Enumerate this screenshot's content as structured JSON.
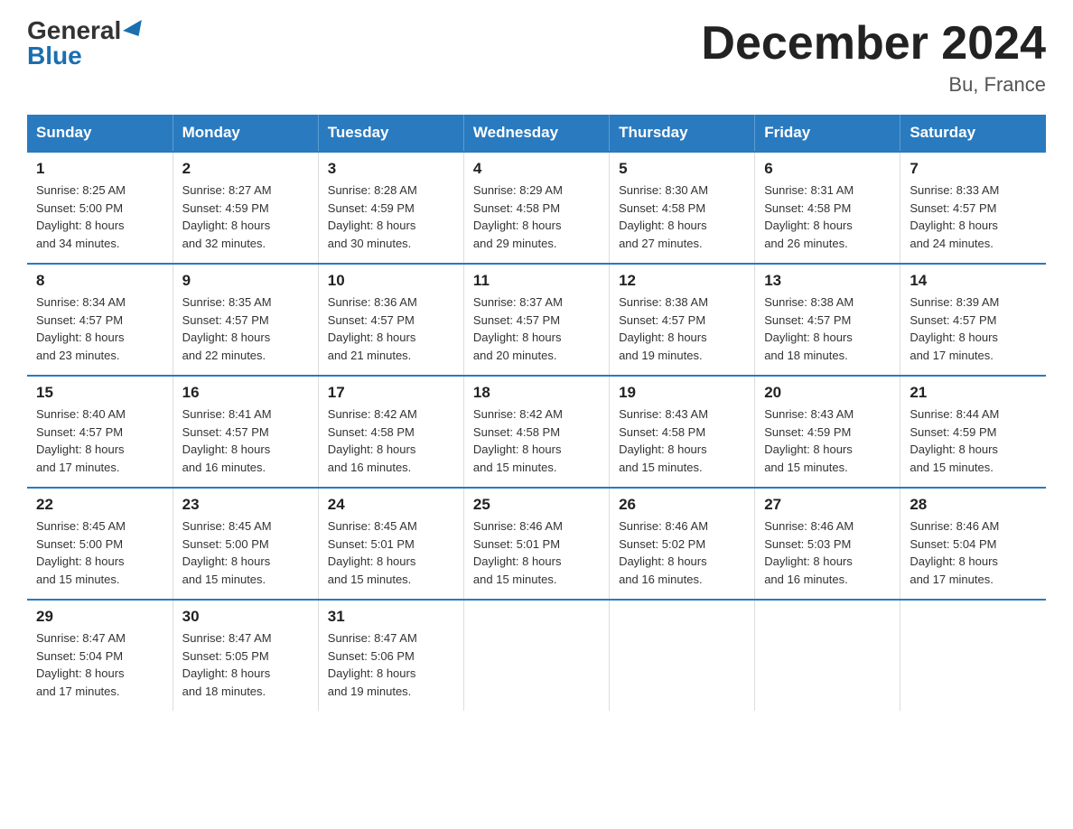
{
  "logo": {
    "general": "General",
    "blue": "Blue"
  },
  "title": "December 2024",
  "location": "Bu, France",
  "days_of_week": [
    "Sunday",
    "Monday",
    "Tuesday",
    "Wednesday",
    "Thursday",
    "Friday",
    "Saturday"
  ],
  "weeks": [
    [
      {
        "day": "1",
        "info": "Sunrise: 8:25 AM\nSunset: 5:00 PM\nDaylight: 8 hours\nand 34 minutes."
      },
      {
        "day": "2",
        "info": "Sunrise: 8:27 AM\nSunset: 4:59 PM\nDaylight: 8 hours\nand 32 minutes."
      },
      {
        "day": "3",
        "info": "Sunrise: 8:28 AM\nSunset: 4:59 PM\nDaylight: 8 hours\nand 30 minutes."
      },
      {
        "day": "4",
        "info": "Sunrise: 8:29 AM\nSunset: 4:58 PM\nDaylight: 8 hours\nand 29 minutes."
      },
      {
        "day": "5",
        "info": "Sunrise: 8:30 AM\nSunset: 4:58 PM\nDaylight: 8 hours\nand 27 minutes."
      },
      {
        "day": "6",
        "info": "Sunrise: 8:31 AM\nSunset: 4:58 PM\nDaylight: 8 hours\nand 26 minutes."
      },
      {
        "day": "7",
        "info": "Sunrise: 8:33 AM\nSunset: 4:57 PM\nDaylight: 8 hours\nand 24 minutes."
      }
    ],
    [
      {
        "day": "8",
        "info": "Sunrise: 8:34 AM\nSunset: 4:57 PM\nDaylight: 8 hours\nand 23 minutes."
      },
      {
        "day": "9",
        "info": "Sunrise: 8:35 AM\nSunset: 4:57 PM\nDaylight: 8 hours\nand 22 minutes."
      },
      {
        "day": "10",
        "info": "Sunrise: 8:36 AM\nSunset: 4:57 PM\nDaylight: 8 hours\nand 21 minutes."
      },
      {
        "day": "11",
        "info": "Sunrise: 8:37 AM\nSunset: 4:57 PM\nDaylight: 8 hours\nand 20 minutes."
      },
      {
        "day": "12",
        "info": "Sunrise: 8:38 AM\nSunset: 4:57 PM\nDaylight: 8 hours\nand 19 minutes."
      },
      {
        "day": "13",
        "info": "Sunrise: 8:38 AM\nSunset: 4:57 PM\nDaylight: 8 hours\nand 18 minutes."
      },
      {
        "day": "14",
        "info": "Sunrise: 8:39 AM\nSunset: 4:57 PM\nDaylight: 8 hours\nand 17 minutes."
      }
    ],
    [
      {
        "day": "15",
        "info": "Sunrise: 8:40 AM\nSunset: 4:57 PM\nDaylight: 8 hours\nand 17 minutes."
      },
      {
        "day": "16",
        "info": "Sunrise: 8:41 AM\nSunset: 4:57 PM\nDaylight: 8 hours\nand 16 minutes."
      },
      {
        "day": "17",
        "info": "Sunrise: 8:42 AM\nSunset: 4:58 PM\nDaylight: 8 hours\nand 16 minutes."
      },
      {
        "day": "18",
        "info": "Sunrise: 8:42 AM\nSunset: 4:58 PM\nDaylight: 8 hours\nand 15 minutes."
      },
      {
        "day": "19",
        "info": "Sunrise: 8:43 AM\nSunset: 4:58 PM\nDaylight: 8 hours\nand 15 minutes."
      },
      {
        "day": "20",
        "info": "Sunrise: 8:43 AM\nSunset: 4:59 PM\nDaylight: 8 hours\nand 15 minutes."
      },
      {
        "day": "21",
        "info": "Sunrise: 8:44 AM\nSunset: 4:59 PM\nDaylight: 8 hours\nand 15 minutes."
      }
    ],
    [
      {
        "day": "22",
        "info": "Sunrise: 8:45 AM\nSunset: 5:00 PM\nDaylight: 8 hours\nand 15 minutes."
      },
      {
        "day": "23",
        "info": "Sunrise: 8:45 AM\nSunset: 5:00 PM\nDaylight: 8 hours\nand 15 minutes."
      },
      {
        "day": "24",
        "info": "Sunrise: 8:45 AM\nSunset: 5:01 PM\nDaylight: 8 hours\nand 15 minutes."
      },
      {
        "day": "25",
        "info": "Sunrise: 8:46 AM\nSunset: 5:01 PM\nDaylight: 8 hours\nand 15 minutes."
      },
      {
        "day": "26",
        "info": "Sunrise: 8:46 AM\nSunset: 5:02 PM\nDaylight: 8 hours\nand 16 minutes."
      },
      {
        "day": "27",
        "info": "Sunrise: 8:46 AM\nSunset: 5:03 PM\nDaylight: 8 hours\nand 16 minutes."
      },
      {
        "day": "28",
        "info": "Sunrise: 8:46 AM\nSunset: 5:04 PM\nDaylight: 8 hours\nand 17 minutes."
      }
    ],
    [
      {
        "day": "29",
        "info": "Sunrise: 8:47 AM\nSunset: 5:04 PM\nDaylight: 8 hours\nand 17 minutes."
      },
      {
        "day": "30",
        "info": "Sunrise: 8:47 AM\nSunset: 5:05 PM\nDaylight: 8 hours\nand 18 minutes."
      },
      {
        "day": "31",
        "info": "Sunrise: 8:47 AM\nSunset: 5:06 PM\nDaylight: 8 hours\nand 19 minutes."
      },
      {
        "day": "",
        "info": ""
      },
      {
        "day": "",
        "info": ""
      },
      {
        "day": "",
        "info": ""
      },
      {
        "day": "",
        "info": ""
      }
    ]
  ]
}
